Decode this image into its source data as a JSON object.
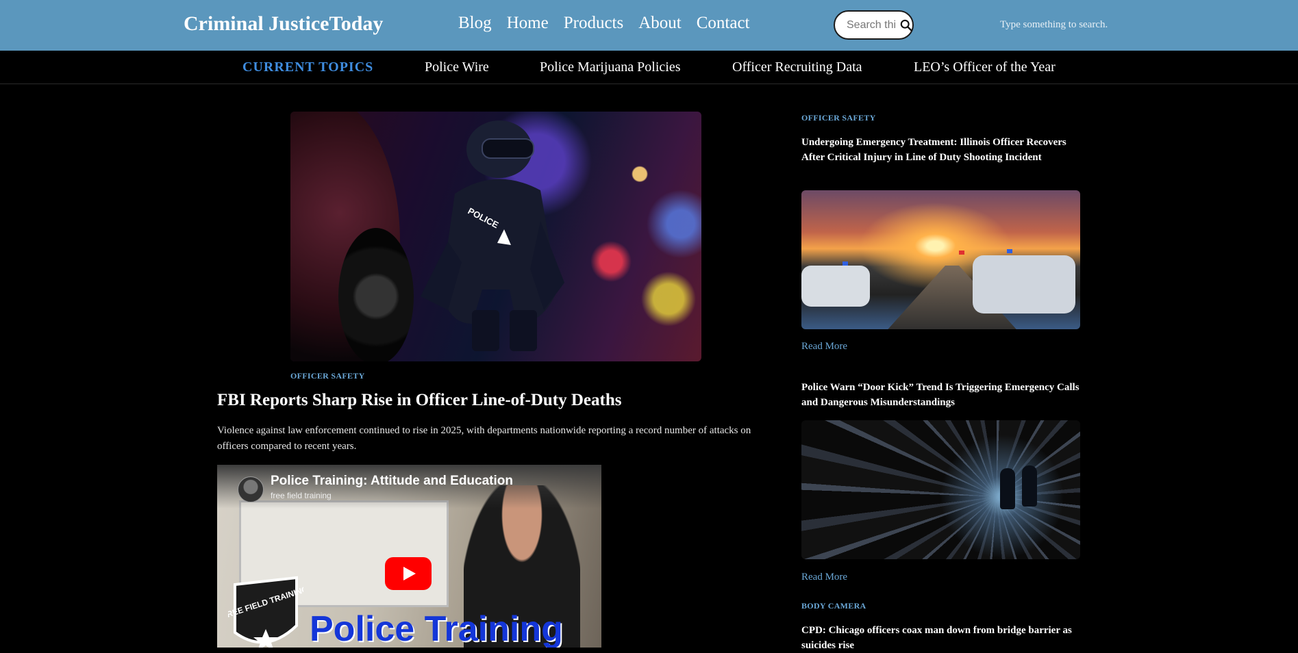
{
  "header": {
    "brand": "Criminal JusticeToday",
    "nav": [
      "Blog",
      "Home",
      "Products",
      "About",
      "Contact"
    ],
    "search_placeholder": "Search this site",
    "search_hint": "Type something to search."
  },
  "topics": {
    "title": "CURRENT TOPICS",
    "links": [
      "Police Wire",
      "Police Marijuana Policies",
      "Officer Recruiting Data",
      "LEO’s Officer of the Year"
    ]
  },
  "main": {
    "category": "OFFICER SAFETY",
    "title": "FBI Reports Sharp Rise in Officer Line-of-Duty Deaths",
    "excerpt": "Violence against law enforcement continued to rise in 2025, with departments nationwide reporting a record number of attacks on officers compared to recent years.",
    "hero_patch_text": "POLICE",
    "video": {
      "title": "Police Training: Attitude and Education",
      "channel": "free field training",
      "shield_text": "FREE FIELD TRAINING",
      "banner": "Police Training"
    }
  },
  "sidebar": {
    "articles": [
      {
        "category": "OFFICER SAFETY",
        "title": "Undergoing Emergency Treatment: Illinois Officer Recovers After Critical Injury in Line of Duty Shooting Incident",
        "read_more": "Read More"
      },
      {
        "title": "Police Warn “Door Kick” Trend Is Triggering Emergency Calls and Dangerous Misunderstandings",
        "read_more": "Read More"
      },
      {
        "category": "BODY CAMERA",
        "title": "CPD: Chicago officers coax man down from bridge barrier as suicides rise"
      }
    ]
  },
  "colors": {
    "header_bg": "#5b97bd",
    "topic_accent": "#3f8de0",
    "category_link": "#6aa7d6",
    "play_button": "#ff0000"
  }
}
